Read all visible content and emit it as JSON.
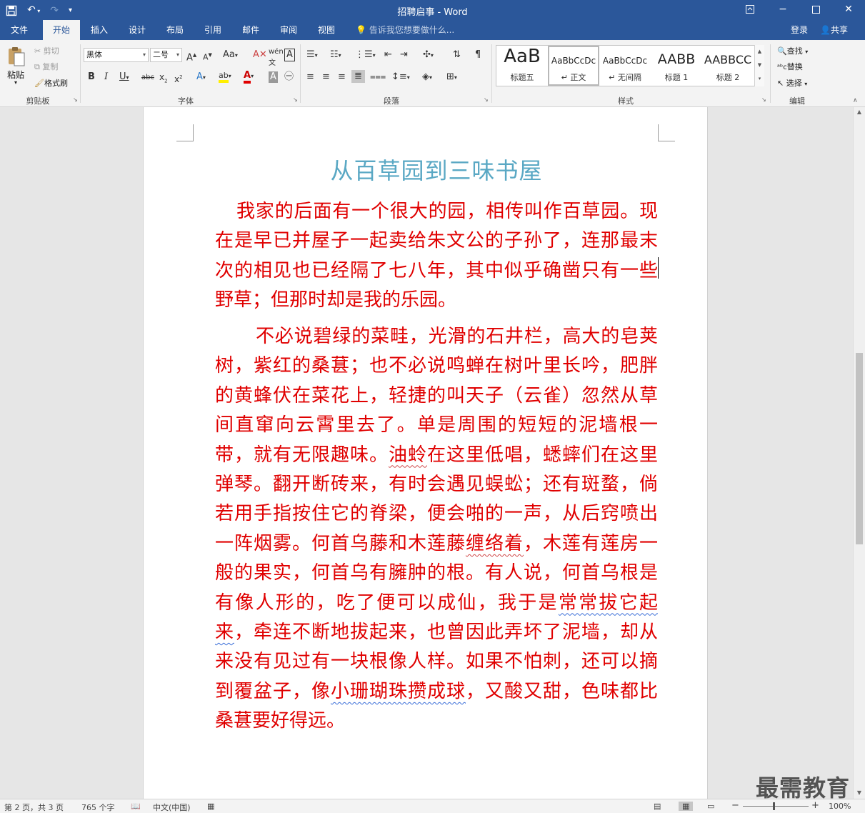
{
  "app": {
    "title": "招聘启事 - Word",
    "qat": {
      "save_icon": "save-icon",
      "undo_icon": "undo-icon",
      "redo_icon": "redo-icon",
      "customize_icon": "customize-qat-icon"
    }
  },
  "window_controls": {
    "ribbon_display": "ribbon-display-icon",
    "minimize": "minimize-icon",
    "maximize": "maximize-icon",
    "close": "close-icon"
  },
  "tabs": [
    {
      "label": "文件"
    },
    {
      "label": "开始"
    },
    {
      "label": "插入"
    },
    {
      "label": "设计"
    },
    {
      "label": "布局"
    },
    {
      "label": "引用"
    },
    {
      "label": "邮件"
    },
    {
      "label": "审阅"
    },
    {
      "label": "视图"
    }
  ],
  "tell_me": "告诉我您想要做什么...",
  "account": {
    "login": "登录",
    "share": "共享"
  },
  "ribbon": {
    "clipboard": {
      "paste": "粘贴",
      "cut": "剪切",
      "copy": "复制",
      "format_painter": "格式刷",
      "label": "剪贴板"
    },
    "font": {
      "font_name": "黑体",
      "font_size": "二号",
      "label": "字体"
    },
    "paragraph": {
      "label": "段落"
    },
    "styles": {
      "label": "样式",
      "items": [
        {
          "sample": "AaB",
          "name": "标题五"
        },
        {
          "sample": "AaBbCcDc",
          "name": "正文"
        },
        {
          "sample": "AaBbCcDc",
          "name": "无间隔"
        },
        {
          "sample": "AABB",
          "name": "标题 1"
        },
        {
          "sample": "AABBCC",
          "name": "标题 2"
        }
      ]
    },
    "editing": {
      "find": "查找",
      "replace": "替换",
      "select": "选择",
      "label": "编辑"
    }
  },
  "document": {
    "title": "从百草园到三味书屋",
    "para1": "我家的后面有一个很大的园，相传叫作百草园。现在是早已并屋子一起卖给朱文公的子孙了，连那最末次的相见也已经隔了七八年，其中似乎确凿只有一些野草；但那时却是我的乐园。",
    "para2_a": "不必说碧绿的菜畦，光滑的石井栏，高大的皂荚树，紫红的桑葚；也不必说鸣蝉在树叶里长吟，肥胖的黄蜂伏在菜花上，轻捷的叫天子（云雀）忽然从草间直窜向云霄里去了。单是周围的短短的泥墙根一带，就有无限趣味。",
    "para2_b": "油蛉",
    "para2_c": "在这里低唱，蟋蟀们在这里弹琴。翻开断砖来，有时会遇见蜈蚣；还有斑蝥，倘若用手指按住它的脊梁，便会啪的一声，从后窍喷出一阵烟雾。何首乌藤和木莲藤",
    "para2_d": "缠络着",
    "para2_e": "，木莲有莲房一般的果实，何首乌有臃肿的根。有人说，何首乌根是有像人形的，吃了便可以成仙，我于是",
    "para2_f": "常常拔它起来",
    "para2_g": "，牵连不断地拔起来，也曾因此弄坏了泥墙，却从来没有见过有一块根像人样。如果不怕刺，还可以摘到覆盆子，像",
    "para2_h": "小珊瑚珠攒成球",
    "para2_i": "，又酸又甜，色味都比桑葚要好得远。"
  },
  "status": {
    "page": "第 2 页，共 3 页",
    "words": "765 个字",
    "language": "中文(中国)",
    "zoom": "100%",
    "zoom_minus": "−",
    "zoom_plus": "+"
  },
  "watermark": "最需教育"
}
